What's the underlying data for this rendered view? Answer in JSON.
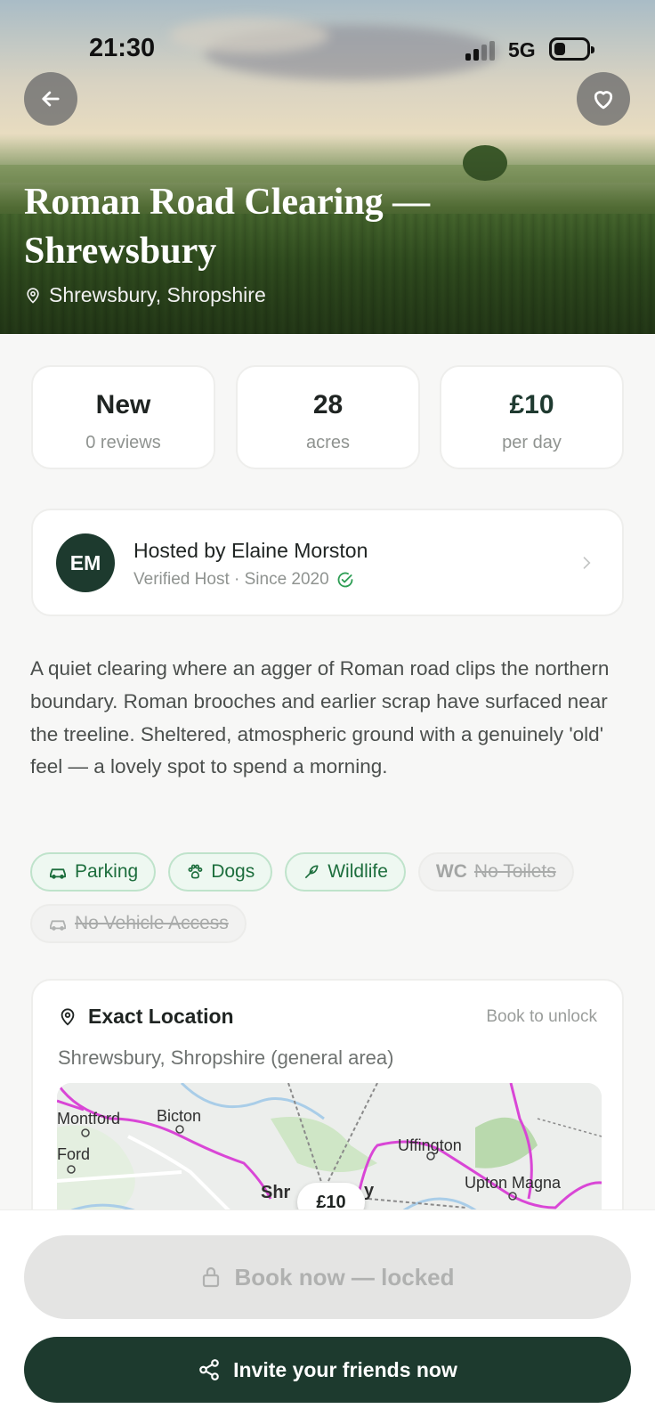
{
  "status_bar": {
    "time": "21:30",
    "network": "5G"
  },
  "hero": {
    "title": "Roman Road Clearing — Shrewsbury",
    "location": "Shrewsbury, Shropshire"
  },
  "stats": [
    {
      "value": "New",
      "label": "0 reviews"
    },
    {
      "value": "28",
      "label": "acres"
    },
    {
      "value": "£10",
      "label": "per day"
    }
  ],
  "host": {
    "initials": "EM",
    "name": "Hosted by Elaine Morston",
    "subtitle": "Verified Host · Since 2020"
  },
  "description": "A quiet clearing where an agger of Roman road clips the northern boundary. Roman brooches and earlier scrap have surfaced near the treeline. Sheltered, atmospheric ground with a genuinely 'old' feel — a lovely spot to spend a morning.",
  "amenities": [
    {
      "label": "Parking",
      "icon": "car-icon",
      "available": true
    },
    {
      "label": "Dogs",
      "icon": "paw-icon",
      "available": true
    },
    {
      "label": "Wildlife",
      "icon": "bird-icon",
      "available": true
    },
    {
      "label": "No Toilets",
      "prefix": "WC",
      "available": false
    },
    {
      "label": "No Vehicle Access",
      "icon": "car-icon",
      "available": false
    }
  ],
  "location": {
    "title": "Exact Location",
    "lock_text": "Book to unlock",
    "area": "Shrewsbury, Shropshire (general area)",
    "map_labels": [
      "Montford",
      "Bicton",
      "Ford",
      "Uffington",
      "Upton Magna",
      "Shr",
      "y"
    ],
    "price_pin": "£10"
  },
  "actions": {
    "book_label": "Book now — locked",
    "invite_label": "Invite your friends now"
  },
  "colors": {
    "brand_dark": "#1d3a2e",
    "chip_green": "#1d6e3d",
    "map_route": "#d946d6"
  }
}
